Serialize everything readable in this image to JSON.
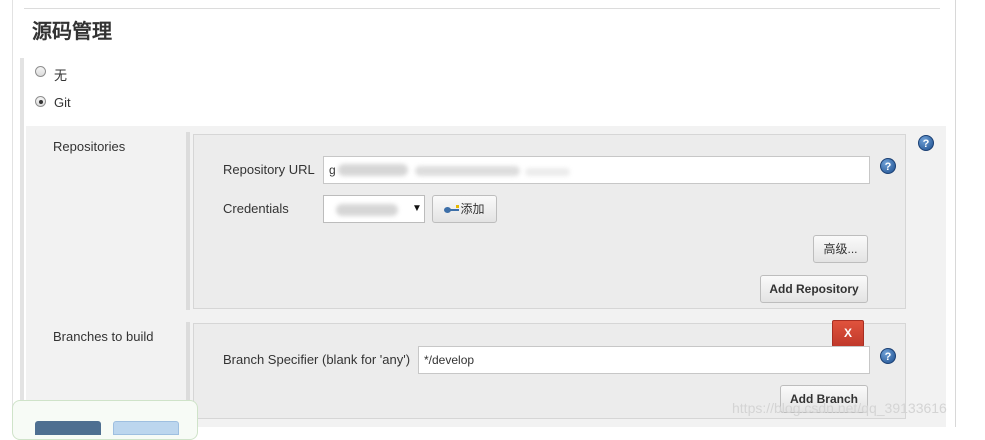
{
  "section": {
    "title": "源码管理"
  },
  "scm_options": [
    {
      "label": "无",
      "checked": false
    },
    {
      "label": "Git",
      "checked": true
    }
  ],
  "repositories": {
    "label": "Repositories",
    "url_label": "Repository URL",
    "url_value": "g",
    "credentials_label": "Credentials",
    "add_label": "添加",
    "advanced_label": "高级...",
    "add_repository_label": "Add Repository"
  },
  "branches": {
    "label": "Branches to build",
    "specifier_label": "Branch Specifier (blank for 'any')",
    "specifier_value": "*/develop",
    "delete_label": "X",
    "add_branch_label": "Add Branch"
  },
  "help_glyph": "?",
  "watermark": "https://blog.csdn.net/qq_39133616",
  "icons": [
    "help-icon",
    "key-icon",
    "dropdown-arrow-icon",
    "radio-icon"
  ],
  "colors": {
    "help_blue": "#2a5a9a",
    "delete_red": "#c9432f"
  }
}
